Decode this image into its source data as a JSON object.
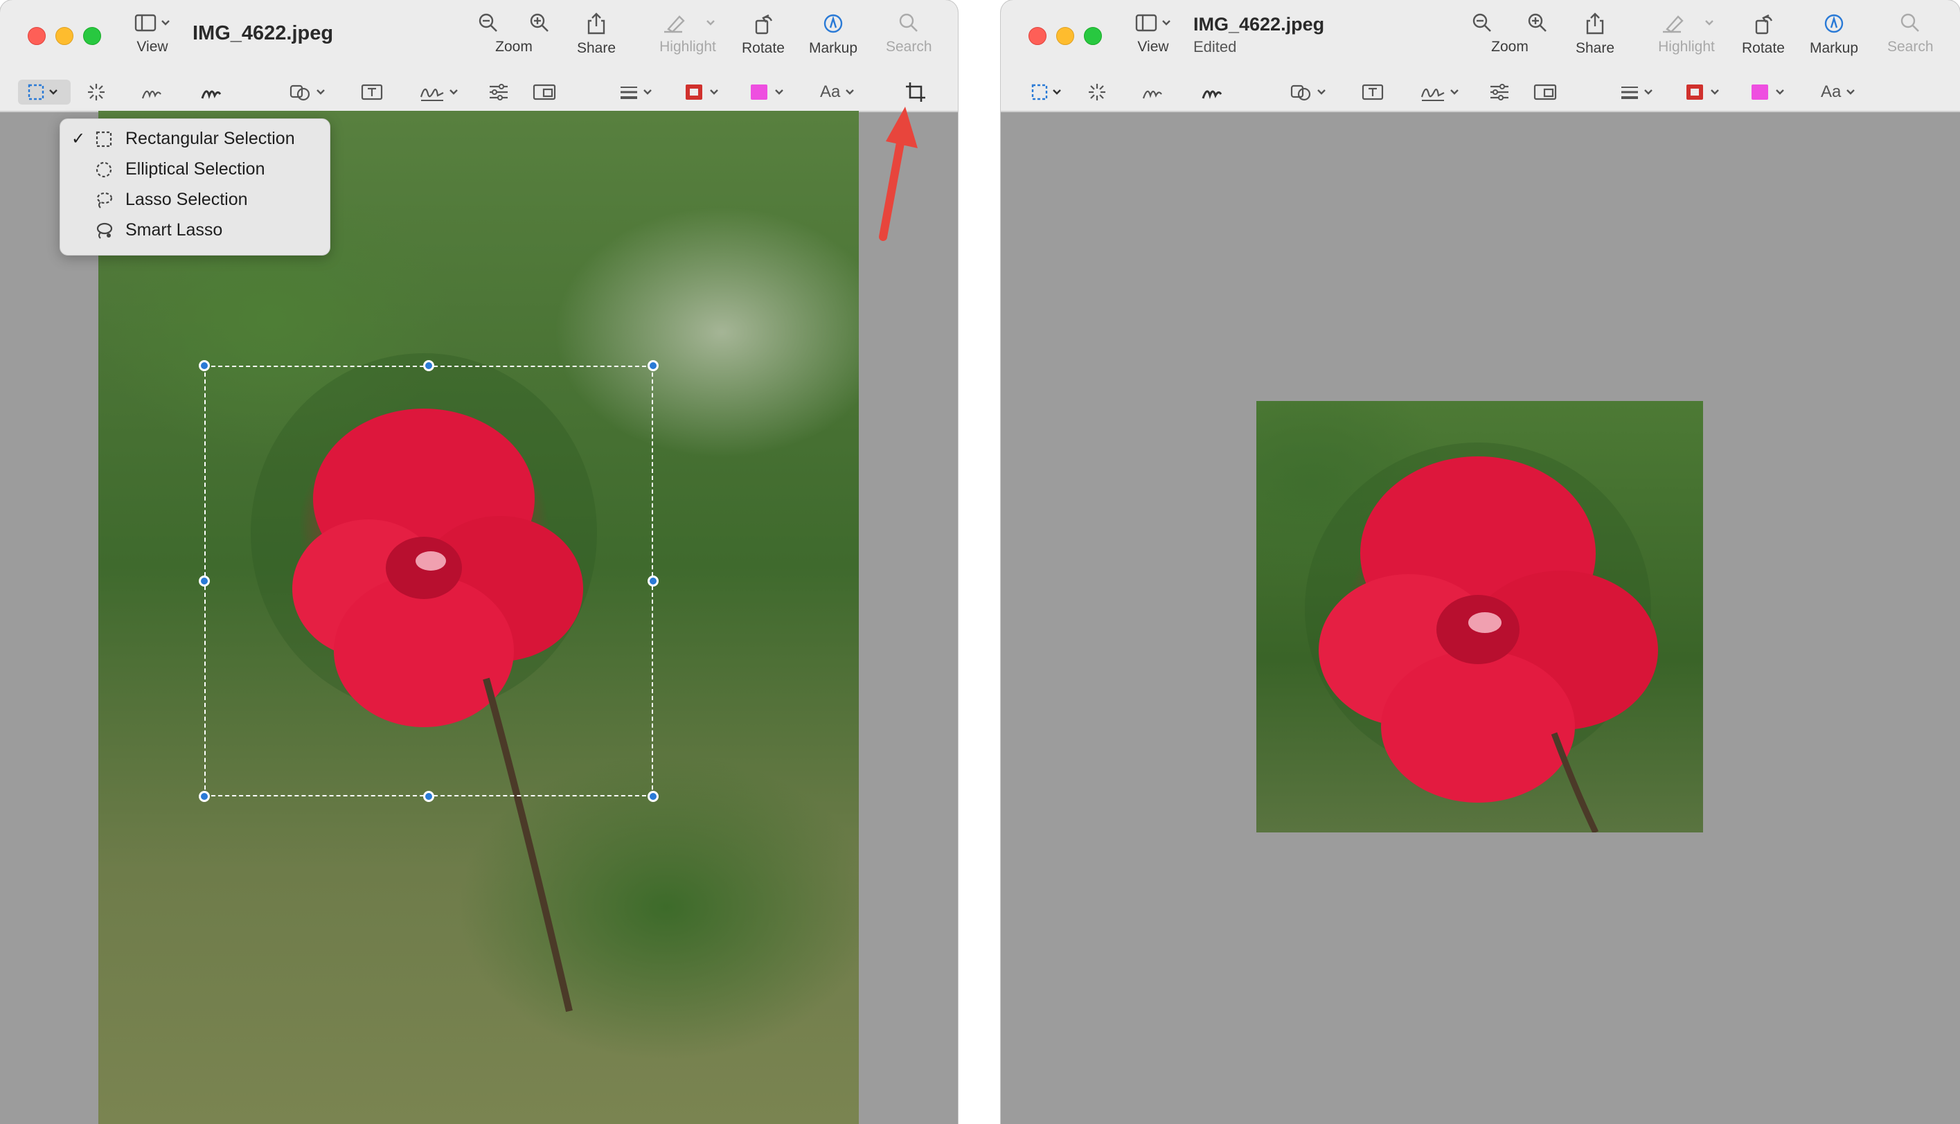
{
  "left_window": {
    "title": "IMG_4622.jpeg",
    "toolbar": {
      "view": "View",
      "zoom": "Zoom",
      "share": "Share",
      "highlight": "Highlight",
      "rotate": "Rotate",
      "markup": "Markup",
      "search": "Search"
    },
    "format_text": "Aa",
    "selection_menu": {
      "items": [
        {
          "label": "Rectangular Selection",
          "checked": true,
          "icon": "rect-selection-icon"
        },
        {
          "label": "Elliptical Selection",
          "checked": false,
          "icon": "ellipse-selection-icon"
        },
        {
          "label": "Lasso Selection",
          "checked": false,
          "icon": "lasso-icon"
        },
        {
          "label": "Smart Lasso",
          "checked": false,
          "icon": "smart-lasso-icon"
        }
      ],
      "check_mark": "✓"
    }
  },
  "right_window": {
    "title": "IMG_4622.jpeg",
    "subtitle": "Edited",
    "toolbar": {
      "view": "View",
      "zoom": "Zoom",
      "share": "Share",
      "highlight": "Highlight",
      "rotate": "Rotate",
      "markup": "Markup",
      "search": "Search"
    },
    "format_text": "Aa"
  },
  "colors": {
    "accent": "#2a7ad6",
    "border_color_swatch": "#d0312d",
    "fill_color_swatch": "#ee4fe0",
    "annotation_arrow": "#e8453c"
  }
}
